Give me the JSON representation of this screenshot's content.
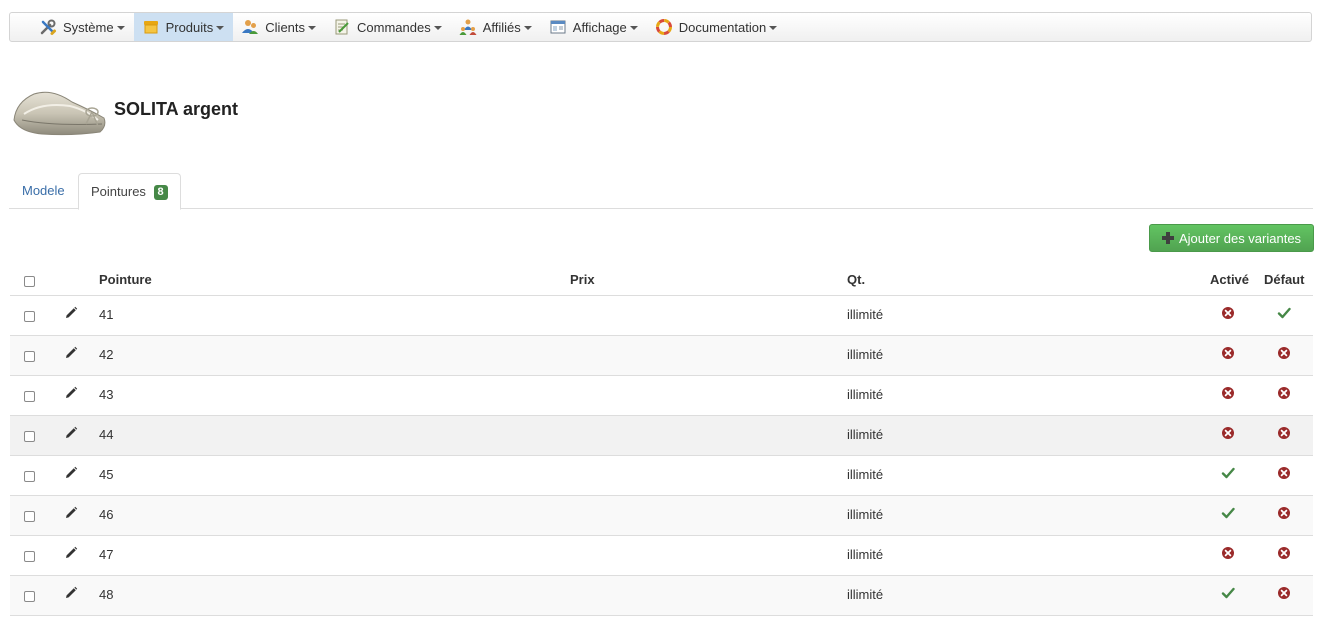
{
  "nav": {
    "items": [
      {
        "label": "Système",
        "icon": "tools-icon",
        "active": false
      },
      {
        "label": "Produits",
        "icon": "box-icon",
        "active": true
      },
      {
        "label": "Clients",
        "icon": "users-icon",
        "active": false
      },
      {
        "label": "Commandes",
        "icon": "order-icon",
        "active": false
      },
      {
        "label": "Affiliés",
        "icon": "affiliates-icon",
        "active": false
      },
      {
        "label": "Affichage",
        "icon": "display-icon",
        "active": false
      },
      {
        "label": "Documentation",
        "icon": "lifebuoy-icon",
        "active": false
      }
    ]
  },
  "product": {
    "title": "SOLITA argent",
    "image": "ballet-flat-shoe-image"
  },
  "tabs": {
    "modele": "Modele",
    "pointures": "Pointures",
    "pointures_count": "8"
  },
  "actions": {
    "add_variants": "Ajouter des variantes"
  },
  "table": {
    "headers": {
      "pointure": "Pointure",
      "prix": "Prix",
      "qt": "Qt.",
      "active": "Activé",
      "default": "Défaut"
    },
    "rows": [
      {
        "size": "41",
        "price": "",
        "qty": "illimité",
        "active": false,
        "default": true
      },
      {
        "size": "42",
        "price": "",
        "qty": "illimité",
        "active": false,
        "default": false
      },
      {
        "size": "43",
        "price": "",
        "qty": "illimité",
        "active": false,
        "default": false
      },
      {
        "size": "44",
        "price": "",
        "qty": "illimité",
        "active": false,
        "default": false
      },
      {
        "size": "45",
        "price": "",
        "qty": "illimité",
        "active": true,
        "default": false
      },
      {
        "size": "46",
        "price": "",
        "qty": "illimité",
        "active": true,
        "default": false
      },
      {
        "size": "47",
        "price": "",
        "qty": "illimité",
        "active": false,
        "default": false
      },
      {
        "size": "48",
        "price": "",
        "qty": "illimité",
        "active": true,
        "default": false
      }
    ]
  },
  "colors": {
    "check": "#468847",
    "cross": "#9a2a2a",
    "link": "#3a6ea8",
    "button": "#51a351"
  }
}
